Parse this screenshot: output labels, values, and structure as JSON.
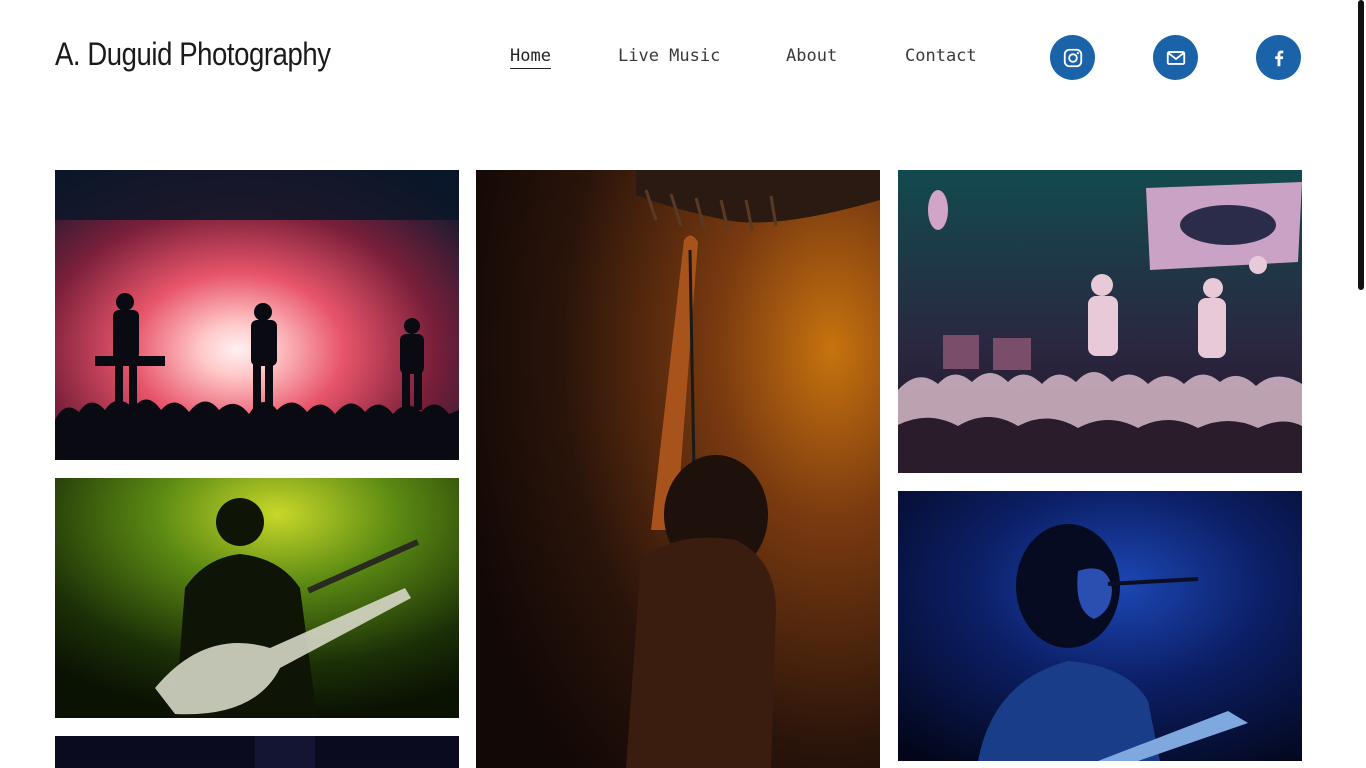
{
  "header": {
    "site_title": "A. Duguid Photography"
  },
  "nav": {
    "items": [
      {
        "label": "Home",
        "active": true
      },
      {
        "label": "Live Music",
        "active": false
      },
      {
        "label": "About",
        "active": false
      },
      {
        "label": "Contact",
        "active": false
      }
    ]
  },
  "social": {
    "color": "#1a63a8",
    "icons": [
      "instagram-icon",
      "email-icon",
      "facebook-icon"
    ]
  },
  "gallery": {
    "photos": [
      {
        "subject": "band-stage-red-burst"
      },
      {
        "subject": "singer-at-microphone-amber"
      },
      {
        "subject": "band-crowd-purple-banner"
      },
      {
        "subject": "bassist-green-light"
      },
      {
        "subject": "singer-guitarist-blue"
      },
      {
        "subject": "dark-stage-partial"
      }
    ]
  }
}
